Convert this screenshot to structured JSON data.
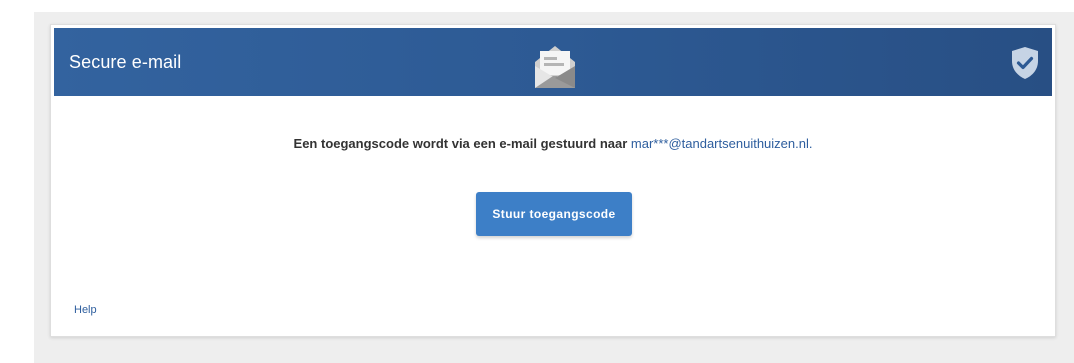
{
  "header": {
    "title": "Secure e-mail",
    "center_icon": "envelope-open-icon",
    "right_icon": "shield-check-icon"
  },
  "main": {
    "message_text": "Een toegangscode wordt via een e-mail gestuurd naar ",
    "email": "mar***@tandartsenuithuizen.nl.",
    "button_label": "Stuur toegangscode"
  },
  "footer": {
    "help_label": "Help"
  },
  "colors": {
    "header": "#2d5a94",
    "button": "#3d7fc7",
    "link": "#2e5e9e",
    "background": "#eeeeee"
  }
}
